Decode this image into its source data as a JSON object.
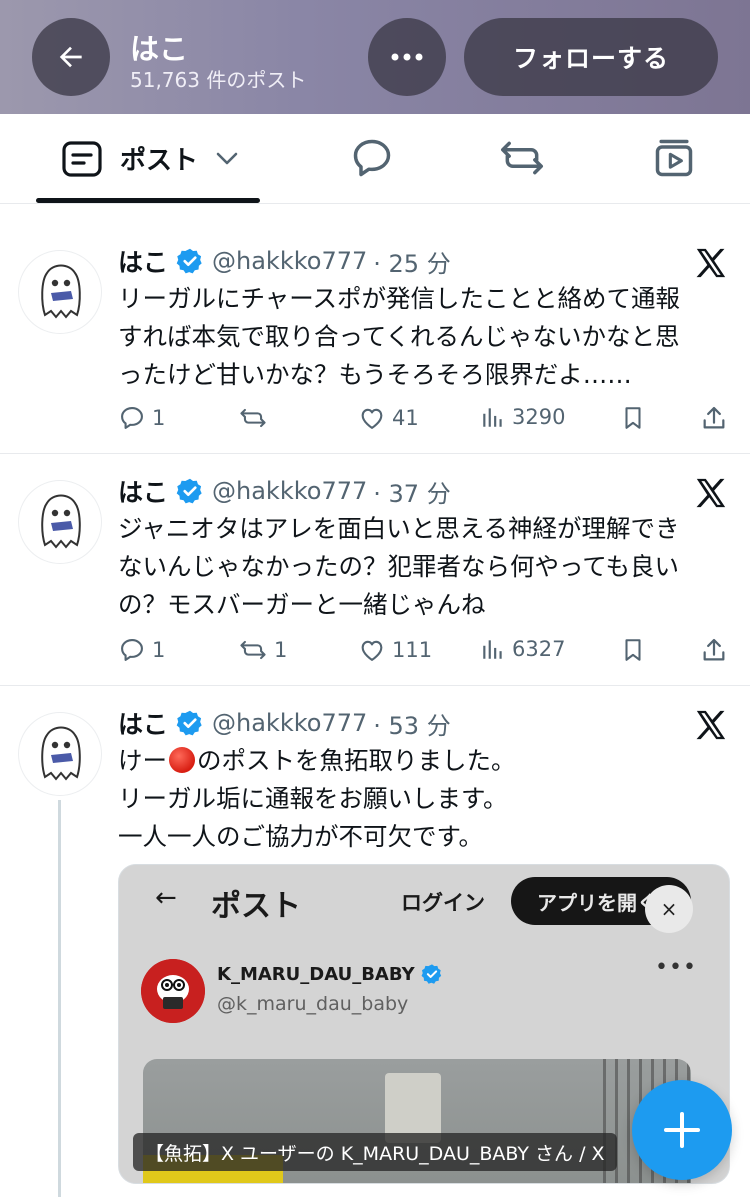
{
  "header": {
    "name": "はこ",
    "post_count": "51,763 件のポスト",
    "follow_label": "フォローする"
  },
  "tabs": {
    "post_label": "ポスト"
  },
  "posts": [
    {
      "name": "はこ",
      "handle": "@hakkko777",
      "time": "· 25 分",
      "lines": [
        "リーガルにチャースポが発信したことと絡めて通報",
        "すれば本気で取り合ってくれるんじゃないかなと思",
        "ったけど甘いかな？もうそろそろ限界だよ……"
      ],
      "replies": "1",
      "reposts": "",
      "likes": "41",
      "views": "3290"
    },
    {
      "name": "はこ",
      "handle": "@hakkko777",
      "time": "· 37 分",
      "lines": [
        "ジャニオタはアレを面白いと思える神経が理解でき",
        "ないんじゃなかったの？犯罪者なら何やっても良い",
        "の？モスバーガーと一緒じゃんね"
      ],
      "replies": "1",
      "reposts": "1",
      "likes": "111",
      "views": "6327"
    },
    {
      "name": "はこ",
      "handle": "@hakkko777",
      "time": "· 53 分",
      "line1_pre": "けー",
      "line1_post": "のポストを魚拓取りました。",
      "lines": [
        "リーガル垢に通報をお願いします。",
        "一人一人のご協力が不可欠です。"
      ]
    }
  ],
  "embed": {
    "back": "←",
    "title": "ポスト",
    "login": "ログイン",
    "app_button": "アプリを開く",
    "close": "×",
    "username": "K_MARU_DAU_BABY",
    "handle": "@k_maru_dau_baby",
    "dots": "•••",
    "caption": "【魚拓】X ユーザーの K_MARU_DAU_BABY さん / X"
  },
  "colors": {
    "accent": "#1d9bf0",
    "muted": "#536471",
    "header_bg": "#8a86a6"
  }
}
